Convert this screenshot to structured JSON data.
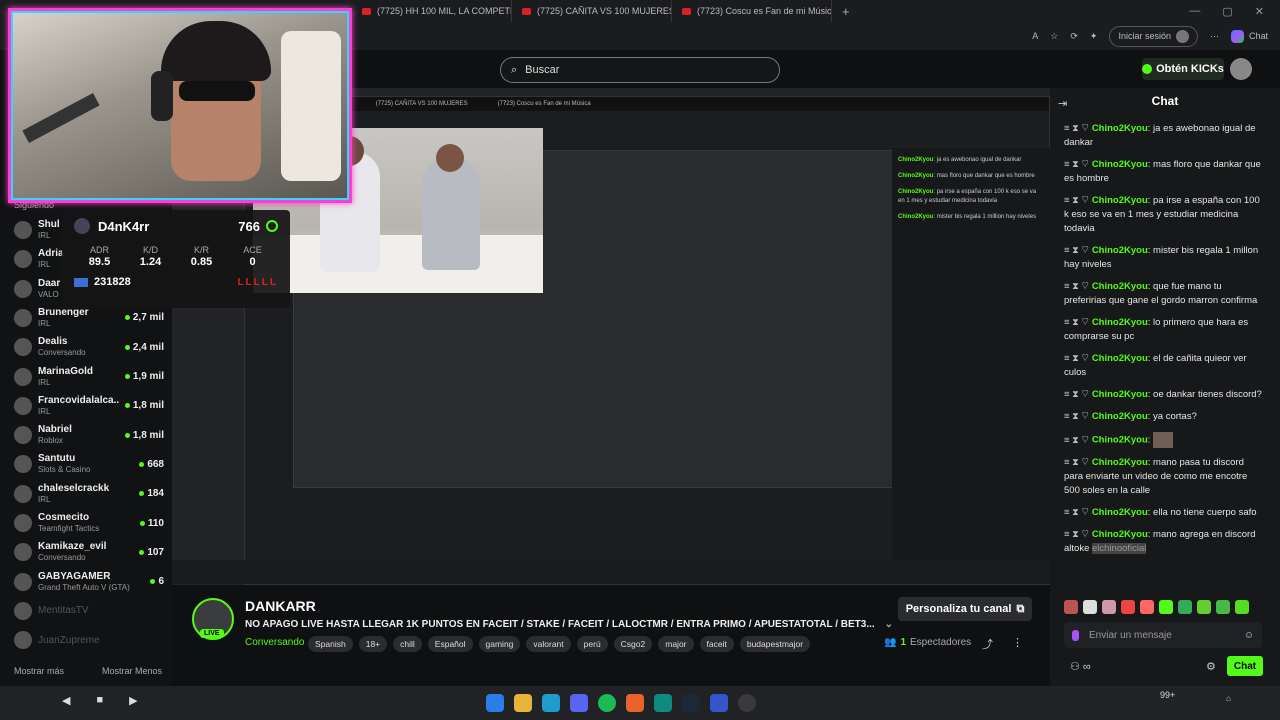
{
  "browser": {
    "tabs": [
      {
        "label": "(7725) HH 100 MIL, LA COMPETE"
      },
      {
        "label": "(7725) CAÑITA VS 100 MUJERES"
      },
      {
        "label": "(7723) Coscu es Fan de mi Música"
      }
    ],
    "signin_label": "Iniciar sesión",
    "copilot_label": "Chat"
  },
  "header": {
    "search_placeholder": "Buscar",
    "kicks_label": "Obtén KICKs"
  },
  "sidebar": {
    "heading": "Siguiendo",
    "items": [
      {
        "name": "Shul",
        "category": "IRL",
        "viewers": ""
      },
      {
        "name": "Adria",
        "category": "IRL",
        "viewers": ""
      },
      {
        "name": "Daar",
        "category": "VALO",
        "viewers": ""
      },
      {
        "name": "Brunenger",
        "category": "IRL",
        "viewers": "2,7 mil"
      },
      {
        "name": "Dealis",
        "category": "Conversando",
        "viewers": "2,4 mil"
      },
      {
        "name": "MarinaGold",
        "category": "IRL",
        "viewers": "1,9 mil"
      },
      {
        "name": "Francovidalalca...",
        "category": "IRL",
        "viewers": "1,8 mil"
      },
      {
        "name": "Nabriel",
        "category": "Roblox",
        "viewers": "1,8 mil"
      },
      {
        "name": "Santutu",
        "category": "Slots & Casino",
        "viewers": "668"
      },
      {
        "name": "chaleselcrackk",
        "category": "IRL",
        "viewers": "184"
      },
      {
        "name": "Cosmecito",
        "category": "Teamfight Tactics",
        "viewers": "110"
      },
      {
        "name": "Kamikaze_evil",
        "category": "Conversando",
        "viewers": "107"
      },
      {
        "name": "GABYAGAMER",
        "category": "Grand Theft Auto V (GTA)",
        "viewers": "6"
      },
      {
        "name": "MentitasTV",
        "category": "",
        "viewers": ""
      },
      {
        "name": "JuanZupreme",
        "category": "",
        "viewers": ""
      }
    ],
    "show_more": "Mostrar más",
    "show_less": "Mostrar Menos"
  },
  "stats_overlay": {
    "player": "D4nK4rr",
    "elo": "766",
    "cols": [
      {
        "label": "ADR",
        "value": "89.5"
      },
      {
        "label": "K/D",
        "value": "1.24"
      },
      {
        "label": "K/R",
        "value": "0.85"
      },
      {
        "label": "ACE",
        "value": "0"
      }
    ],
    "points": "231828",
    "streak": "LLLLL"
  },
  "nested_chat": [
    {
      "user": "Chino2Kyou",
      "text": "ja es awebonao igual de dankar"
    },
    {
      "user": "Chino2Kyou",
      "text": "mas floro que dankar que es hombre"
    },
    {
      "user": "Chino2Kyou",
      "text": "pa irse a españa con 100 k eso se va en 1 mes y estudiar medicina todavia"
    },
    {
      "user": "Chino2Kyou",
      "text": "mister bis regala 1 million hay niveles"
    }
  ],
  "channel": {
    "name": "DANKARR",
    "live_label": "LIVE",
    "title": "NO APAGO LIVE HASTA LLEGAR 1K PUNTOS EN FACEIT / STAKE / FACEIT / LALOCTMR / ENTRA PRIMO / APUESTATOTAL / BET3...",
    "category": "Conversando",
    "tags": [
      "Spanish",
      "18+",
      "chill",
      "Español",
      "gaming",
      "valorant",
      "perú",
      "Csgo2",
      "major",
      "faceit",
      "budapestmajor"
    ],
    "promo_label": "Personaliza tu canal",
    "viewers_count": "1",
    "viewers_label": "Espectadores"
  },
  "chat": {
    "title": "Chat",
    "messages": [
      {
        "user": "Chino2Kyou",
        "text": "ja es awebonao igual de dankar"
      },
      {
        "user": "Chino2Kyou",
        "text": "mas floro que dankar que es hombre"
      },
      {
        "user": "Chino2Kyou",
        "text": "pa irse a españa con 100 k eso se va en 1 mes y estudiar medicina todavia"
      },
      {
        "user": "Chino2Kyou",
        "text": "mister bis regala 1 millon hay niveles"
      },
      {
        "user": "Chino2Kyou",
        "text": "que fue mano tu preferirias que gane el gordo marron confirma"
      },
      {
        "user": "Chino2Kyou",
        "text": "lo primero que hara es comprarse su pc"
      },
      {
        "user": "Chino2Kyou",
        "text": "el de cañita quieor ver culos"
      },
      {
        "user": "Chino2Kyou",
        "text": "oe dankar tienes discord?"
      },
      {
        "user": "Chino2Kyou",
        "text": "ya cortas?"
      },
      {
        "user": "Chino2Kyou",
        "text": "",
        "has_image": true
      },
      {
        "user": "Chino2Kyou",
        "text": "mano pasa tu discord para enviarte un video de como me encotre 500 soles en la calle"
      },
      {
        "user": "Chino2Kyou",
        "text": "ella no tiene cuerpo safo"
      },
      {
        "user": "Chino2Kyou",
        "text": "mano agrega en discord altoke",
        "highlight": "elchinooficial"
      }
    ],
    "input_placeholder": "Enviar un mensaje",
    "send_label": "Chat"
  },
  "taskbar": {
    "badge": "99+"
  },
  "colors": {
    "accent": "#53fc18",
    "webcam_border": "#ff3ecf",
    "webcam_inner": "#31d7ff"
  }
}
